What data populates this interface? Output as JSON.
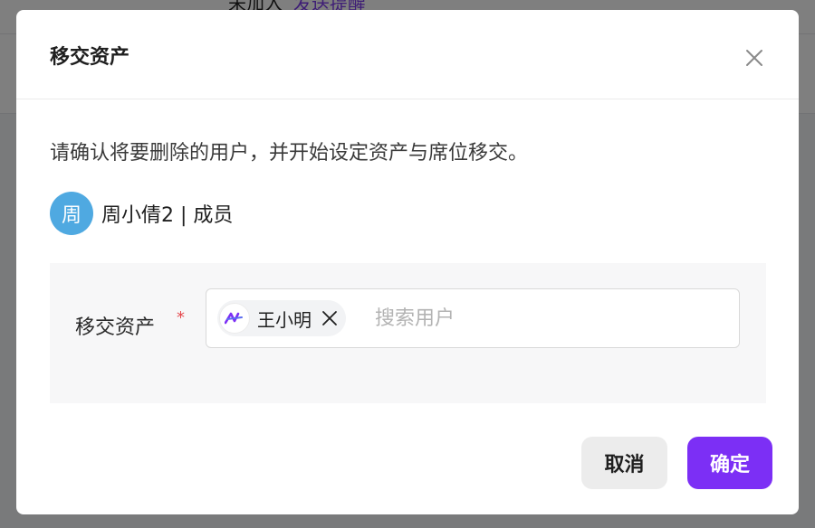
{
  "background": {
    "hint_text": "未加入",
    "hint_link": "发送提醒"
  },
  "dialog": {
    "title": "移交资产",
    "close_icon": "close-icon",
    "description": "请确认将要删除的用户，并开始设定资产与席位移交。",
    "user": {
      "avatar_text": "周",
      "avatar_color": "#4fa9e1",
      "label": "周小倩2 | 成员"
    },
    "form": {
      "label": "移交资产",
      "required_mark": "*",
      "selected_tag": {
        "label": "王小明",
        "avatar_icon": "logo-icon"
      },
      "search_placeholder": "搜索用户",
      "search_value": ""
    },
    "buttons": {
      "cancel": "取消",
      "confirm": "确定"
    },
    "accent_color": "#7c2ff5"
  }
}
